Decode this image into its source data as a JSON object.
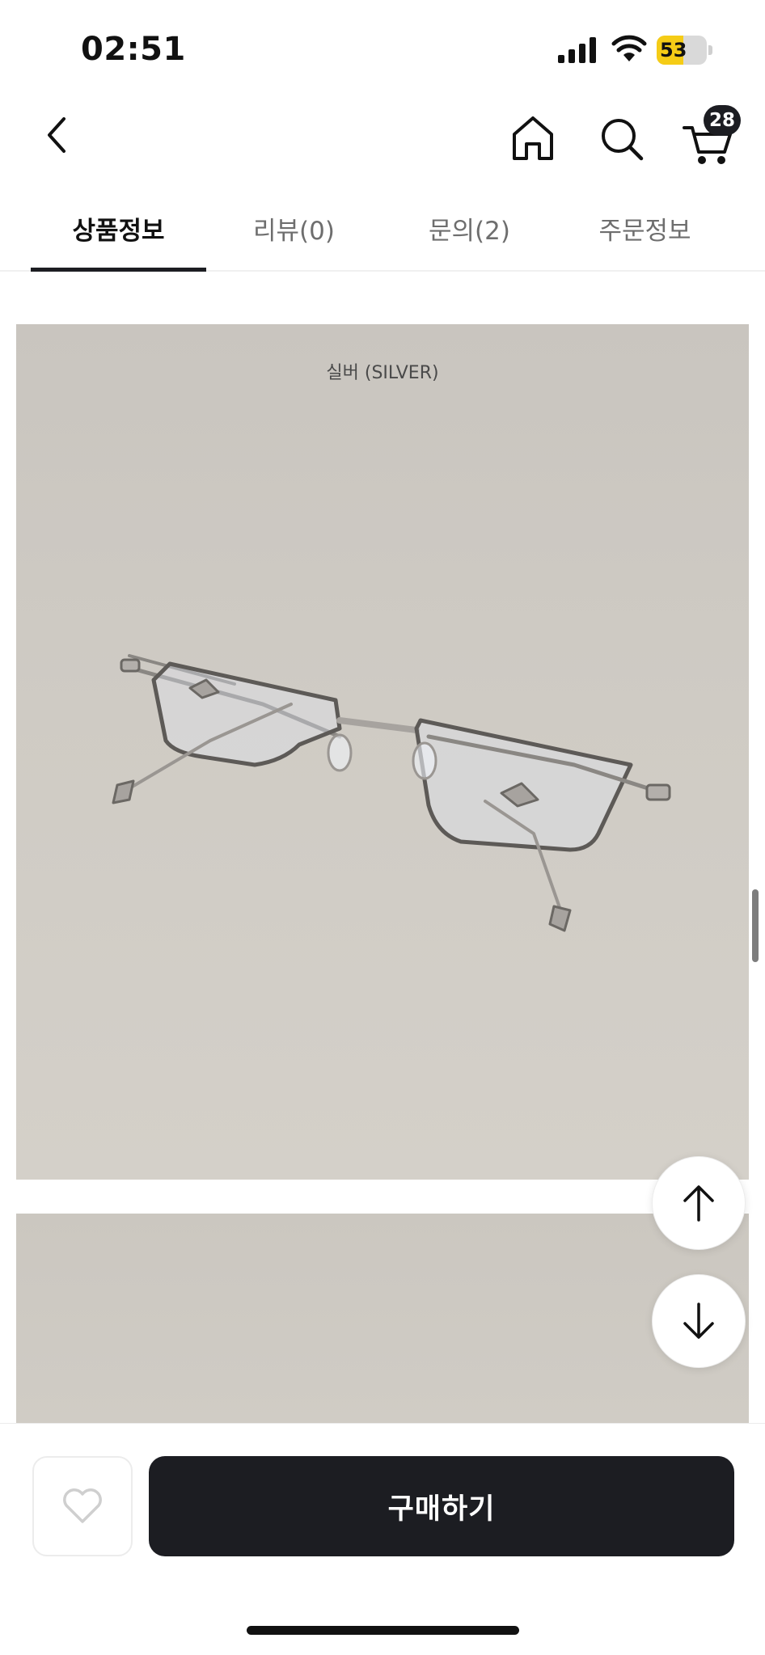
{
  "status_bar": {
    "time": "02:51",
    "battery_level": "53",
    "battery_fraction": 0.53,
    "battery_color": "#f5cc16"
  },
  "header": {
    "back_icon": "chevron-left-icon",
    "home_icon": "home-icon",
    "search_icon": "search-icon",
    "cart_icon": "cart-icon",
    "cart_count": "28"
  },
  "tabs": [
    {
      "label": "상품정보",
      "active": true
    },
    {
      "label": "리뷰(0)",
      "active": false
    },
    {
      "label": "문의(2)",
      "active": false
    },
    {
      "label": "주문정보",
      "active": false
    }
  ],
  "product": {
    "color_caption": "실버 (SILVER)"
  },
  "floating": {
    "up_icon": "arrow-up-icon",
    "down_icon": "arrow-down-icon"
  },
  "bottom_bar": {
    "wishlist_icon": "heart-icon",
    "buy_label": "구매하기"
  },
  "colors": {
    "primary": "#1c1d22",
    "background": "#ffffff"
  }
}
